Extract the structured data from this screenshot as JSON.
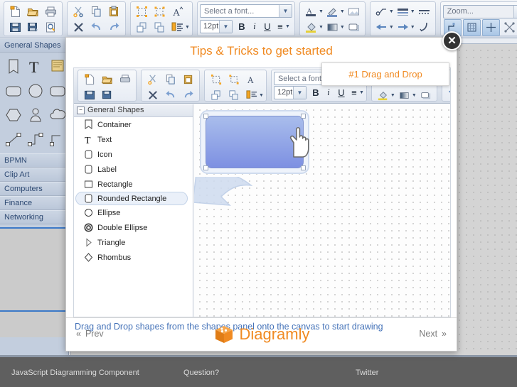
{
  "toolbar": {
    "groups": [
      {
        "name": "file",
        "icons_row1": [
          "new-file-icon",
          "open-folder-icon",
          "print-icon"
        ],
        "icons_row2": [
          "save-icon",
          "save-as-icon",
          "print-preview-icon"
        ]
      },
      {
        "name": "edit",
        "icons_row1": [
          "cut-icon",
          "copy-icon",
          "paste-icon"
        ],
        "icons_row2": [
          "delete-icon",
          "undo-icon",
          "redo-icon"
        ]
      },
      {
        "name": "arrange",
        "icons_row1": [
          "group-icon",
          "ungroup-icon",
          "text-style-icon"
        ],
        "icons_row2": [
          "bring-front-icon",
          "send-back-icon",
          "align-icon"
        ]
      }
    ],
    "font_placeholder": "Select a font...",
    "font_size": "12pt",
    "bold_label": "B",
    "italic_label": "i",
    "underline_label": "U",
    "align_label": "≡",
    "zoom_placeholder": "Zoom...",
    "help_icon": "help-globe-icon"
  },
  "sidebar": {
    "sections": [
      {
        "label": "General Shapes",
        "expanded": true
      },
      {
        "label": "BPMN",
        "expanded": false
      },
      {
        "label": "Clip Art",
        "expanded": false
      },
      {
        "label": "Computers",
        "expanded": false
      },
      {
        "label": "Finance",
        "expanded": false
      },
      {
        "label": "Networking",
        "expanded": false
      }
    ],
    "shape_icons": [
      [
        "container-icon",
        "text-icon",
        "note-icon"
      ],
      [
        "rounded-rectangle-icon",
        "ellipse-icon",
        "rounded-rectangle-icon"
      ],
      [
        "hexagon-icon",
        "actor-icon",
        "cloud-icon"
      ],
      [
        "line-icon",
        "elbow-connector-icon",
        "step-connector-icon"
      ]
    ]
  },
  "dialog": {
    "title": "Tips & Tricks to get started",
    "close_label": "✕",
    "tip_badge": "#1 Drag and Drop",
    "caption": "Drag and Drop shapes from the shapes panel onto the canvas to start drawing",
    "prev_label": "Prev",
    "prev_chevron": "«",
    "next_label": "Next",
    "next_chevron": "»",
    "brand_name": "Diagramly",
    "brand_logo_icon": "diagramly-box-logo",
    "mini_toolbar": {
      "font_placeholder": "Select a font...",
      "font_size": "12pt",
      "bold_label": "B",
      "italic_label": "i",
      "underline_label": "U",
      "align_label": "≡"
    },
    "shapes_panel": {
      "header": "General Shapes",
      "collapse_glyph": "−",
      "items": [
        {
          "label": "Container",
          "icon": "container-icon"
        },
        {
          "label": "Text",
          "icon": "text-icon"
        },
        {
          "label": "Icon",
          "icon": "icon-shape-icon"
        },
        {
          "label": "Label",
          "icon": "label-shape-icon"
        },
        {
          "label": "Rectangle",
          "icon": "rectangle-icon"
        },
        {
          "label": "Rounded Rectangle",
          "icon": "rounded-rectangle-icon"
        },
        {
          "label": "Ellipse",
          "icon": "ellipse-icon"
        },
        {
          "label": "Double Ellipse",
          "icon": "double-ellipse-icon"
        },
        {
          "label": "Triangle",
          "icon": "triangle-icon"
        },
        {
          "label": "Rhombus",
          "icon": "rhombus-icon"
        }
      ],
      "selected_index": 5
    },
    "canvas": {
      "cursor_icon": "hand-pointer-cursor",
      "shape": "rounded-rectangle-selected"
    }
  },
  "footer": {
    "items": [
      {
        "label": "JavaScript Diagramming Component"
      },
      {
        "label": "Question?"
      },
      {
        "label": "Twitter"
      }
    ]
  },
  "colors": {
    "accent_orange": "#f08a22",
    "caption_blue": "#4472b8",
    "shape_top": "#a9bdec",
    "shape_bottom": "#7d90e2",
    "footer_bg": "#5f5f5f"
  }
}
